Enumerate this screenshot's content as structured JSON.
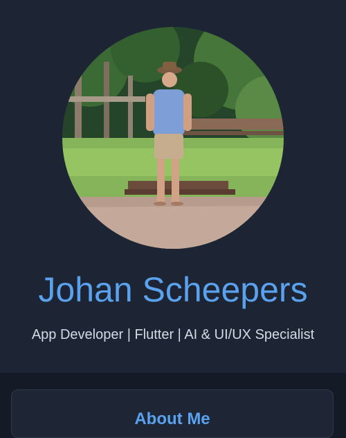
{
  "profile": {
    "name": "Johan Scheepers",
    "tagline": "App Developer | Flutter | AI & UI/UX Specialist",
    "avatar_icon": "profile-photo"
  },
  "about": {
    "title": "About Me"
  },
  "colors": {
    "background": "#141b27",
    "hero_background": "#1d2534",
    "accent": "#5aa2ee",
    "text": "#d5dbe5"
  }
}
